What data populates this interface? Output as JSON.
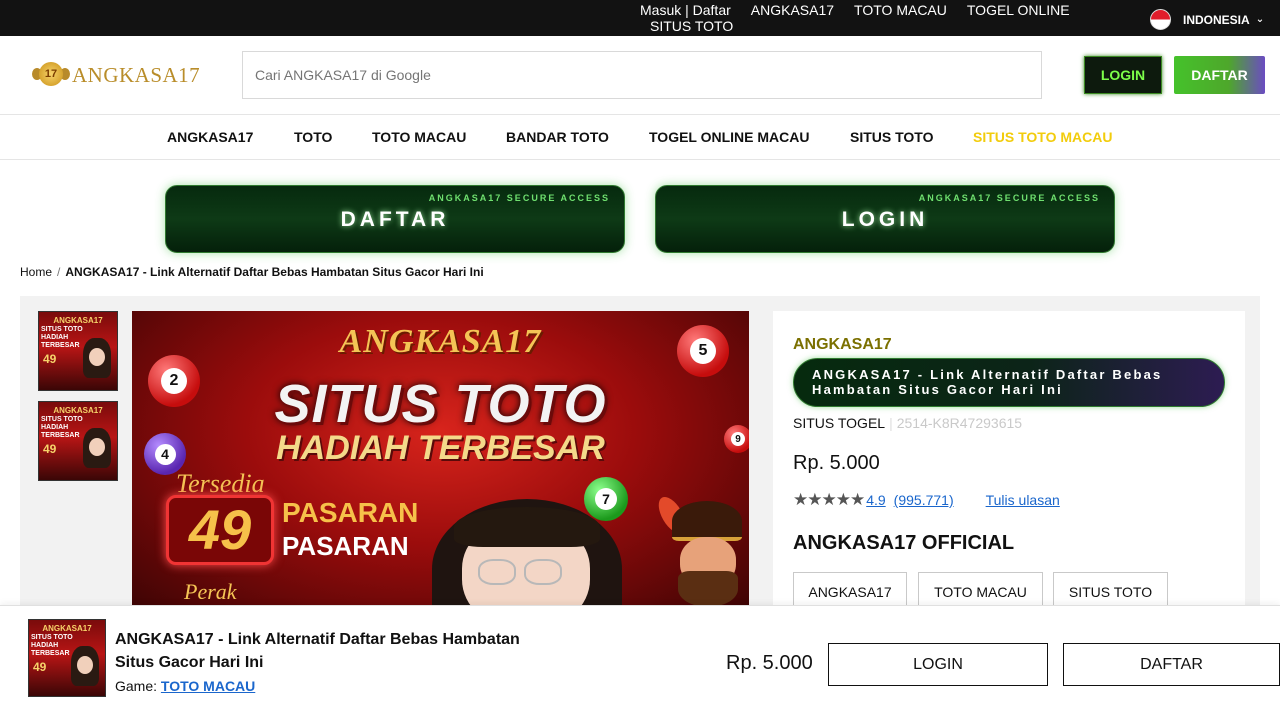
{
  "topbar": {
    "links": [
      "Masuk | Daftar",
      "ANGKASA17",
      "TOTO MACAU",
      "TOGEL ONLINE"
    ],
    "link_second_line": "SITUS TOTO",
    "language": "INDONESIA"
  },
  "header": {
    "logo_text": "ANGKASA17",
    "logo_badge": "17",
    "search_placeholder": "Cari ANGKASA17 di Google",
    "login_label": "LOGIN",
    "daftar_label": "DAFTAR"
  },
  "nav": {
    "items": [
      "ANGKASA17",
      "TOTO",
      "TOTO MACAU",
      "BANDAR TOTO",
      "TOGEL ONLINE MACAU",
      "SITUS TOTO",
      "SITUS TOTO MACAU"
    ],
    "active_index": 6
  },
  "access_buttons": {
    "tag": "ANGKASA17 SECURE ACCESS",
    "daftar": "DAFTAR",
    "login": "LOGIN"
  },
  "breadcrumb": {
    "home": "Home",
    "current": "ANGKASA17 - Link Alternatif Daftar Bebas Hambatan Situs Gacor Hari Ini"
  },
  "hero": {
    "brand": "ANGKASA17",
    "title1": "SITUS TOTO",
    "title2": "HADIAH TERBESAR",
    "tersedia": "Tersedia",
    "count": "49",
    "pasaran1": "PASARAN",
    "pasaran2": "PASARAN",
    "perak": "Perak",
    "balls": [
      "2",
      "5",
      "4",
      "7",
      "9"
    ]
  },
  "thumb": {
    "brand": "ANGKASA17",
    "title": "SITUS TOTO HADIAH TERBESAR",
    "count": "49"
  },
  "product": {
    "store": "ANGKASA17",
    "title": "ANGKASA17 - Link Alternatif Daftar Bebas Hambatan Situs Gacor Hari Ini",
    "category": "SITUS TOGEL",
    "sku": "2514-K8R47293615",
    "price": "Rp. 5.000",
    "stars": "★★★★★",
    "rating": "4.9",
    "rating_count": "(995.771)",
    "write_review": "Tulis ulasan",
    "official": "ANGKASA17 OFFICIAL",
    "options": [
      "ANGKASA17",
      "TOTO MACAU",
      "SITUS TOTO"
    ]
  },
  "sticky": {
    "title": "ANGKASA17 - Link Alternatif Daftar Bebas Hambatan Situs Gacor Hari Ini",
    "game_label": "Game:",
    "game_link": "TOTO MACAU",
    "price": "Rp. 5.000",
    "login": "LOGIN",
    "daftar": "DAFTAR"
  },
  "colors": {
    "topbar": "#121212",
    "accent_green": "#45c22b",
    "nav_active": "#f2cc0c",
    "store_name": "#7b7000",
    "link": "#1a66cc"
  }
}
